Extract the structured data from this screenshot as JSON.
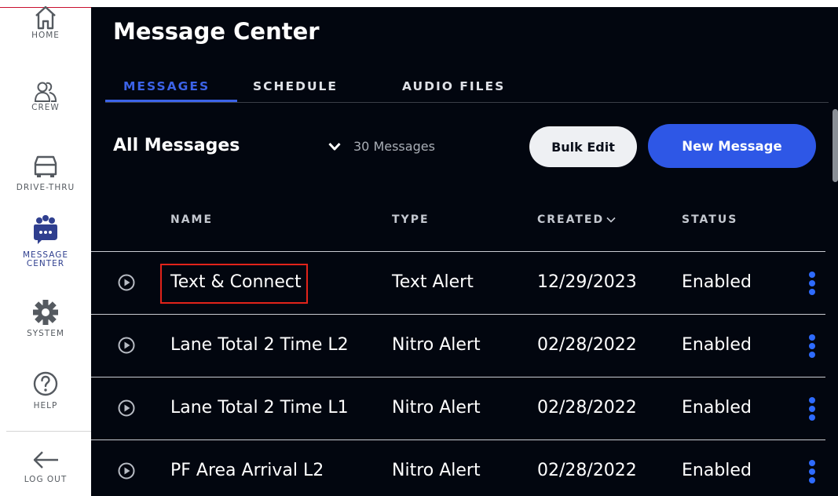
{
  "sidebar": {
    "items": [
      {
        "label": "HOME",
        "icon": "home-icon"
      },
      {
        "label": "CREW",
        "icon": "crew-icon"
      },
      {
        "label": "DRIVE-THRU",
        "icon": "car-icon"
      },
      {
        "label_line1": "MESSAGE",
        "label_line2": "CENTER",
        "icon": "message-center-icon"
      },
      {
        "label": "SYSTEM",
        "icon": "gear-icon"
      },
      {
        "label": "HELP",
        "icon": "help-icon"
      },
      {
        "label": "LOG OUT",
        "icon": "arrow-left-icon"
      }
    ]
  },
  "header": {
    "title": "Message Center"
  },
  "tabs": [
    {
      "label": "MESSAGES"
    },
    {
      "label": "SCHEDULE"
    },
    {
      "label": "AUDIO FILES"
    }
  ],
  "toolbar": {
    "filter_value": "All Messages",
    "count_text": "30 Messages",
    "bulk_edit_label": "Bulk Edit",
    "new_message_label": "New Message"
  },
  "table": {
    "columns": [
      "NAME",
      "TYPE",
      "CREATED",
      "STATUS"
    ],
    "rows": [
      {
        "name": "Text & Connect",
        "type": "Text Alert",
        "created": "12/29/2023",
        "status": "Enabled"
      },
      {
        "name": "Lane Total 2 Time L2",
        "type": "Nitro Alert",
        "created": "02/28/2022",
        "status": "Enabled"
      },
      {
        "name": "Lane Total 2 Time L1",
        "type": "Nitro Alert",
        "created": "02/28/2022",
        "status": "Enabled"
      },
      {
        "name": "PF Area Arrival L2",
        "type": "Nitro Alert",
        "created": "02/28/2022",
        "status": "Enabled"
      }
    ]
  },
  "colors": {
    "accent": "#2e57e6",
    "background": "#02060f",
    "highlight": "#e2231a",
    "kebab": "#2e6bff"
  }
}
